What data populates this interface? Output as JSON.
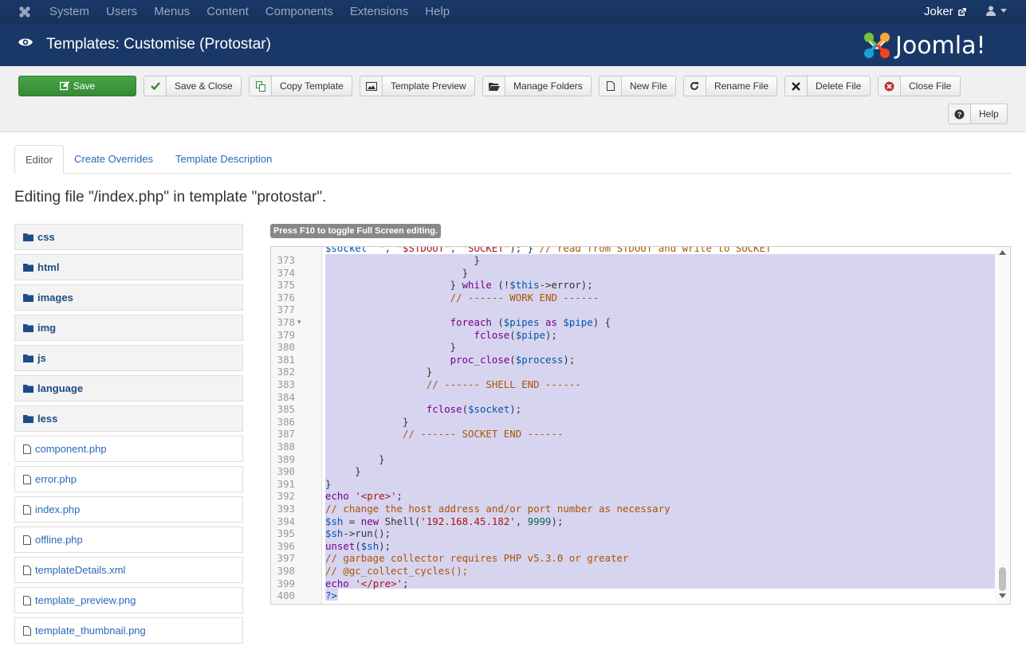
{
  "topnav": {
    "menu": [
      "System",
      "Users",
      "Menus",
      "Content",
      "Components",
      "Extensions",
      "Help"
    ],
    "user": "Joker"
  },
  "header": {
    "title": "Templates: Customise (Protostar)",
    "brand": "Joomla!"
  },
  "toolbar": {
    "save": "Save",
    "save_close": "Save & Close",
    "copy_template": "Copy Template",
    "template_preview": "Template Preview",
    "manage_folders": "Manage Folders",
    "new_file": "New File",
    "rename_file": "Rename File",
    "delete_file": "Delete File",
    "close_file": "Close File",
    "help": "Help"
  },
  "tabs": [
    "Editor",
    "Create Overrides",
    "Template Description"
  ],
  "editing_title": "Editing file \"/index.php\" in template \"protostar\".",
  "folders": [
    "css",
    "html",
    "images",
    "img",
    "js",
    "language",
    "less"
  ],
  "files": [
    "component.php",
    "error.php",
    "index.php",
    "offline.php",
    "templateDetails.xml",
    "template_preview.png",
    "template_thumbnail.png"
  ],
  "hint": "Press F10 to toggle Full Screen editing.",
  "code": {
    "top_partial": "$socket  , $STDOUT , SOCKET ); } // read from STDOUT and write to SOCKET",
    "line_numbers": [
      "373",
      "374",
      "375",
      "376",
      "377",
      "378",
      "379",
      "380",
      "381",
      "382",
      "383",
      "384",
      "385",
      "386",
      "387",
      "388",
      "389",
      "390",
      "391",
      "392",
      "393",
      "394",
      "395",
      "396",
      "397",
      "398",
      "399",
      "400"
    ]
  },
  "colors": {
    "nav": "#1a3867",
    "save": "#46a546",
    "link": "#2a69b8",
    "selection": "#d7d4f0"
  }
}
